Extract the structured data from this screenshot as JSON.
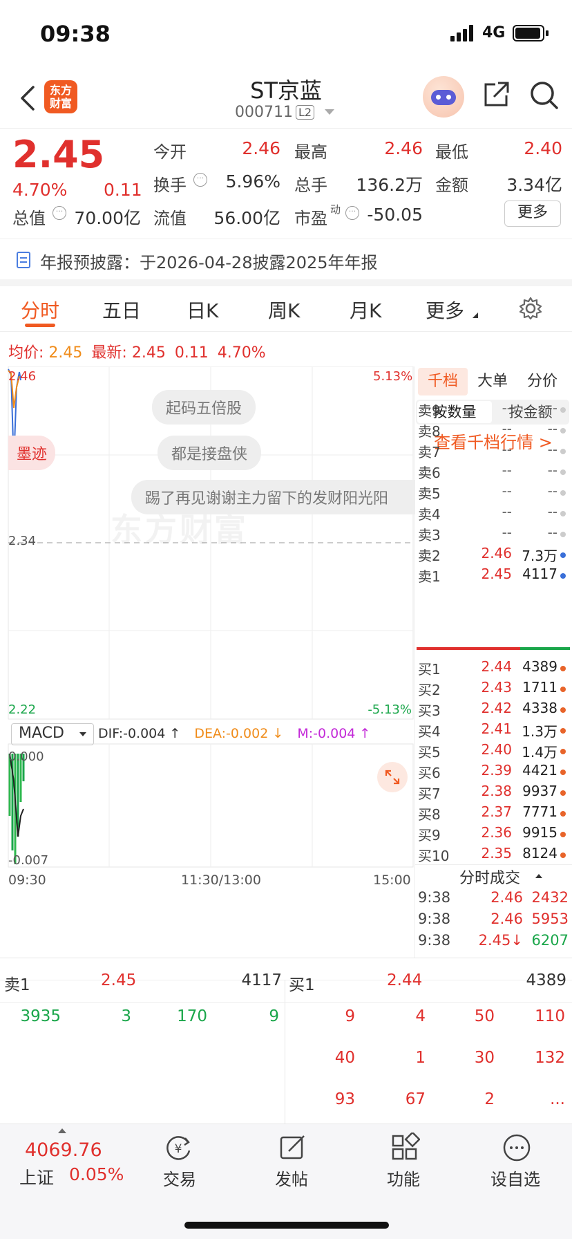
{
  "status": {
    "time": "09:38",
    "network": "4G"
  },
  "header": {
    "title": "ST京蓝",
    "code": "000711",
    "level": "L2",
    "logo_text": "东方\n财富"
  },
  "quote": {
    "price": "2.45",
    "change_pct": "4.70%",
    "change": "0.11",
    "open_label": "今开",
    "open": "2.46",
    "high_label": "最高",
    "high": "2.46",
    "low_label": "最低",
    "low": "2.40",
    "turnover_label": "换手",
    "turnover": "5.96%",
    "volume_label": "总手",
    "volume": "136.2万",
    "amount_label": "金额",
    "amount": "3.34亿",
    "mktcap_label": "总值",
    "mktcap": "70.00亿",
    "float_label": "流值",
    "float": "56.00亿",
    "pe_label": "市盈",
    "pe_sup": "动",
    "pe": "-50.05",
    "more_button": "更多"
  },
  "notice": {
    "text": "年报预披露：于2026-04-28披露2025年年报"
  },
  "tabs": {
    "items": [
      "分时",
      "五日",
      "日K",
      "周K",
      "月K",
      "更多"
    ],
    "active": "分时"
  },
  "chart_info": {
    "avg_label": "均价:",
    "avg": "2.45",
    "latest_label": "最新:",
    "latest": "2.45",
    "change": "0.11",
    "change_pct": "4.70%"
  },
  "chart": {
    "y_top": "2.46",
    "y_mid": "2.34",
    "y_bottom": "2.22",
    "pct_top": "5.13%",
    "pct_bottom": "-5.13%",
    "watermark": "东方财富",
    "bubbles": [
      "起码五倍股",
      "都是接盘侠",
      "踢了再见谢谢主力留下的发财阳光阳"
    ],
    "side_bubble": "墨迹"
  },
  "macd": {
    "selector": "MACD",
    "dif": "DIF:-0.004 ↑",
    "dea": "DEA:-0.002 ↓",
    "m": "M:-0.004 ↑",
    "y_top": "0.000",
    "y_bottom": "-0.007"
  },
  "time_axis": {
    "start": "09:30",
    "mid": "11:30/13:00",
    "end": "15:00"
  },
  "orderbook": {
    "tabs": [
      "千档",
      "大单",
      "分价"
    ],
    "subtabs": [
      "按数量",
      "按金额"
    ],
    "link": "查看千档行情 >",
    "sells": [
      {
        "l": "卖9",
        "p": "--",
        "v": "--"
      },
      {
        "l": "卖8",
        "p": "--",
        "v": "--"
      },
      {
        "l": "卖7",
        "p": "--",
        "v": "--"
      },
      {
        "l": "卖6",
        "p": "--",
        "v": "--"
      },
      {
        "l": "卖5",
        "p": "--",
        "v": "--"
      },
      {
        "l": "卖4",
        "p": "--",
        "v": "--"
      },
      {
        "l": "卖3",
        "p": "--",
        "v": "--"
      },
      {
        "l": "卖2",
        "p": "2.46",
        "v": "7.3万"
      },
      {
        "l": "卖1",
        "p": "2.45",
        "v": "4117"
      }
    ],
    "buys": [
      {
        "l": "买1",
        "p": "2.44",
        "v": "4389"
      },
      {
        "l": "买2",
        "p": "2.43",
        "v": "1711"
      },
      {
        "l": "买3",
        "p": "2.42",
        "v": "4338"
      },
      {
        "l": "买4",
        "p": "2.41",
        "v": "1.3万"
      },
      {
        "l": "买5",
        "p": "2.40",
        "v": "1.4万"
      },
      {
        "l": "买6",
        "p": "2.39",
        "v": "4421"
      },
      {
        "l": "买7",
        "p": "2.38",
        "v": "9937"
      },
      {
        "l": "买8",
        "p": "2.37",
        "v": "7771"
      },
      {
        "l": "买9",
        "p": "2.36",
        "v": "9915"
      },
      {
        "l": "买10",
        "p": "2.35",
        "v": "8124"
      }
    ],
    "trades_title": "分时成交",
    "trades": [
      {
        "t": "9:38",
        "p": "2.46",
        "v": "2432"
      },
      {
        "t": "9:38",
        "p": "2.46",
        "v": "5953"
      },
      {
        "t": "9:38",
        "p": "2.45↓",
        "v": "6207"
      }
    ]
  },
  "bottom": {
    "sell_label": "卖1",
    "sell_price": "2.45",
    "sell_vol": "4117",
    "buy_label": "买1",
    "buy_price": "2.44",
    "buy_vol": "4389",
    "sell_orders": [
      "3935",
      "3",
      "170",
      "9"
    ],
    "buy_orders": [
      [
        "9",
        "4",
        "50",
        "110"
      ],
      [
        "40",
        "1",
        "30",
        "132"
      ],
      [
        "93",
        "67",
        "2",
        "..."
      ]
    ]
  },
  "footer": {
    "index_value": "4069.76",
    "index_name": "上证",
    "index_pct": "0.05%",
    "items": [
      "交易",
      "发帖",
      "功能",
      "设自选"
    ]
  },
  "colors": {
    "up": "#e0302d",
    "down": "#1aa64a",
    "accent": "#f05a22"
  }
}
